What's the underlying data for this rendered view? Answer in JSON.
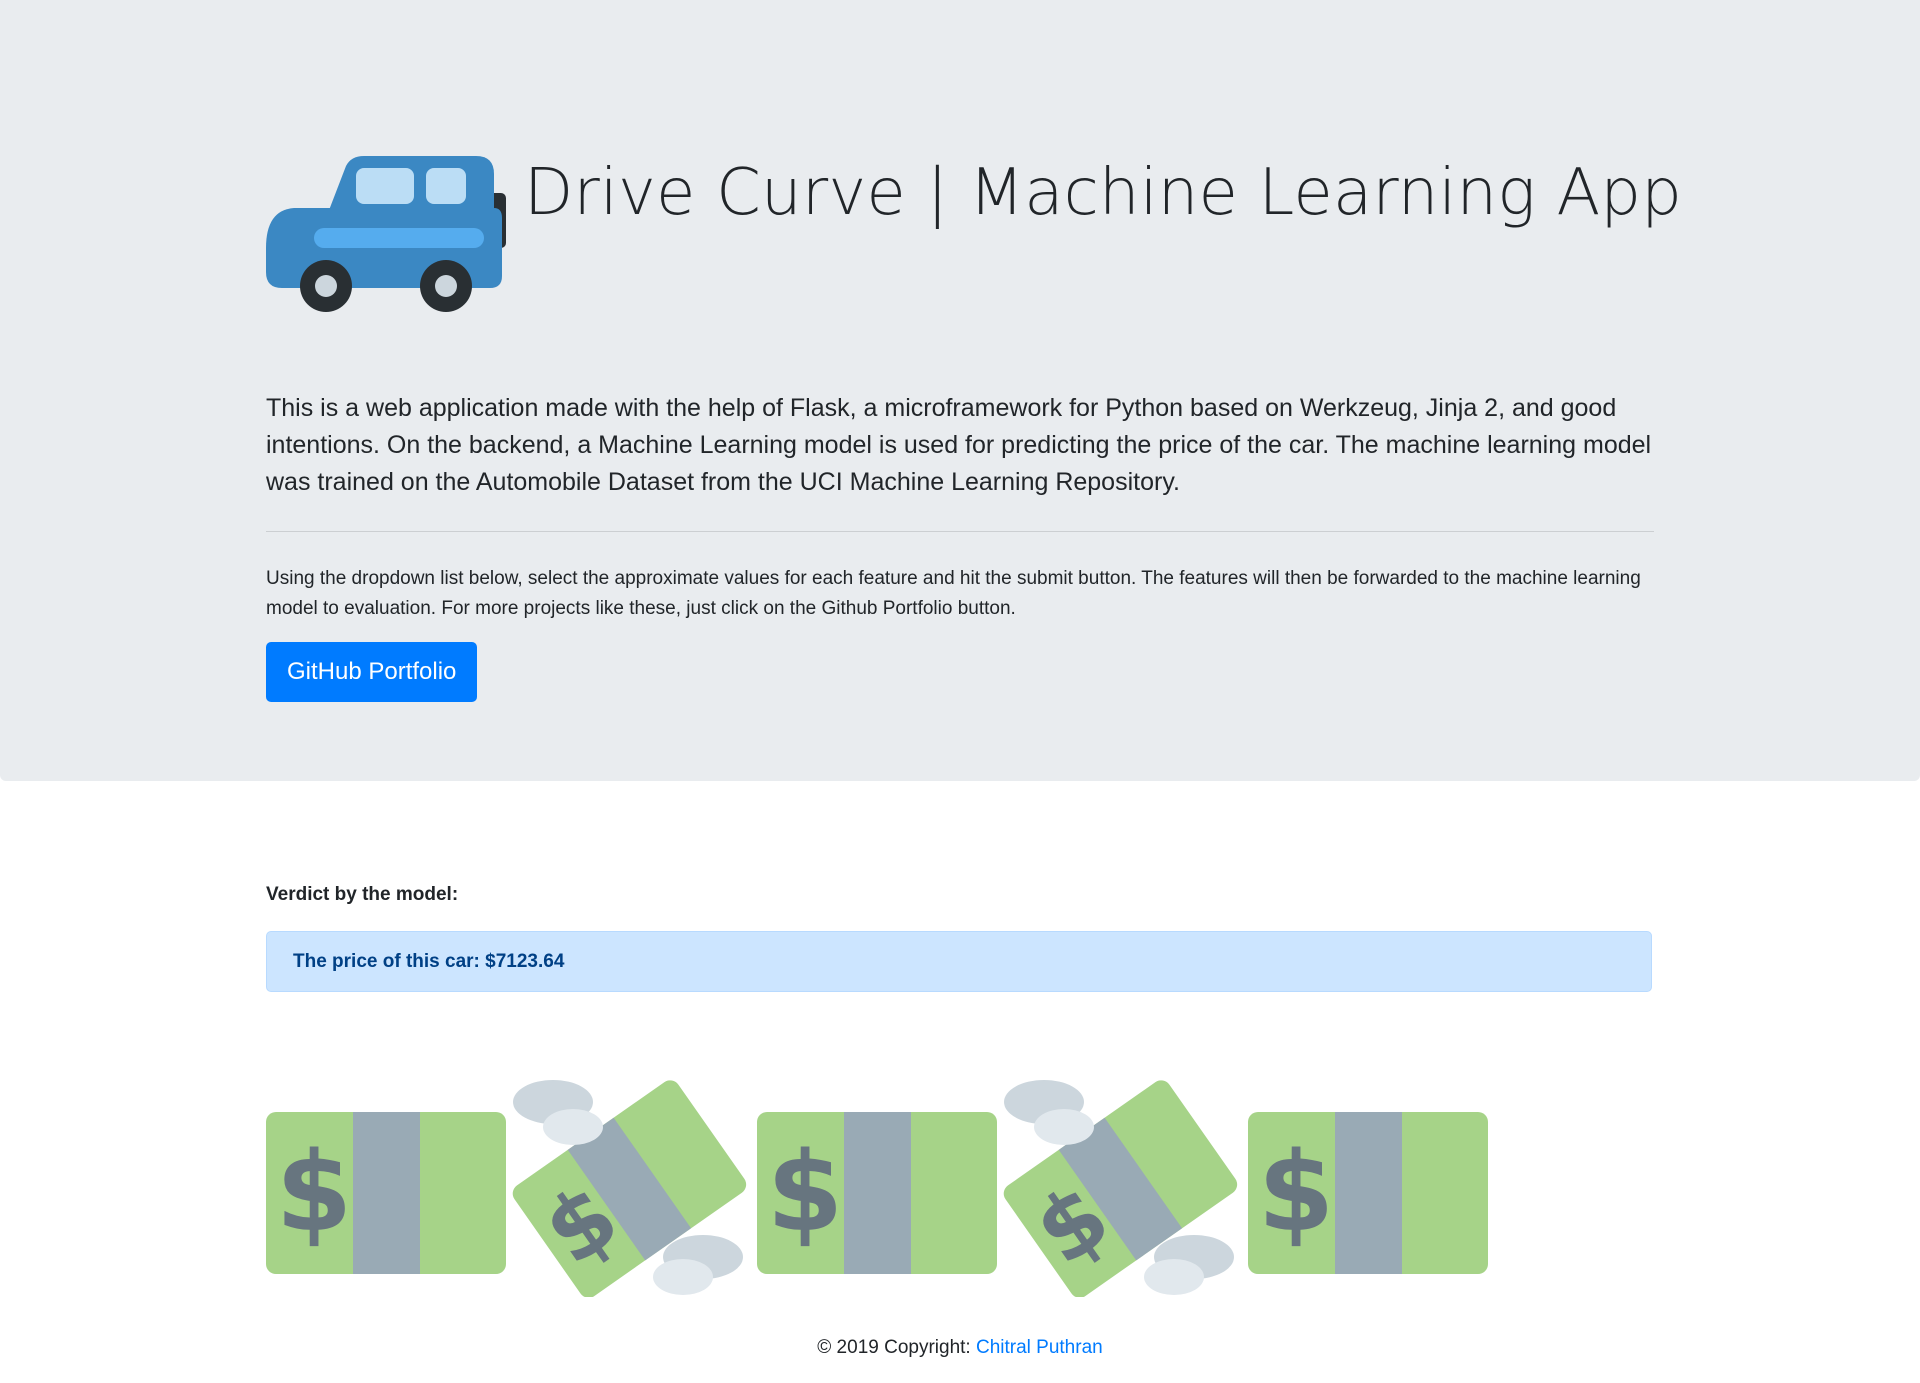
{
  "header": {
    "title": "Drive Curve | Machine Learning App",
    "lead": "This is a web application made with the help of Flask, a microframework for Python based on Werkzeug, Jinja 2, and good intentions. On the backend, a Machine Learning model is used for predicting the price of the car. The machine learning model was trained on the Automobile Dataset from the UCI Machine Learning Repository.",
    "description": "Using the dropdown list below, select the approximate values for each feature and hit the submit button. The features will then be forwarded to the machine learning model to evaluation. For more projects like these, just click on the Github Portfolio button.",
    "button_label": "GitHub Portfolio",
    "car_icon": "blue-car-icon"
  },
  "result": {
    "label": "Verdict by the model:",
    "message": "The price of this car: $7123.64"
  },
  "money_icons": [
    "dollar-banknote-icon",
    "money-with-wings-icon",
    "dollar-banknote-icon",
    "money-with-wings-icon",
    "dollar-banknote-icon"
  ],
  "footer": {
    "copyright": "© 2019 Copyright: ",
    "author": "Chitral Puthran"
  },
  "colors": {
    "jumbotron": "#e9ecef",
    "primary": "#007bff",
    "alert_bg": "#cce5ff",
    "alert_text": "#004085",
    "bill_green": "#a6d388",
    "bill_band": "#99aab5",
    "dollar_sign": "#5c913b"
  }
}
